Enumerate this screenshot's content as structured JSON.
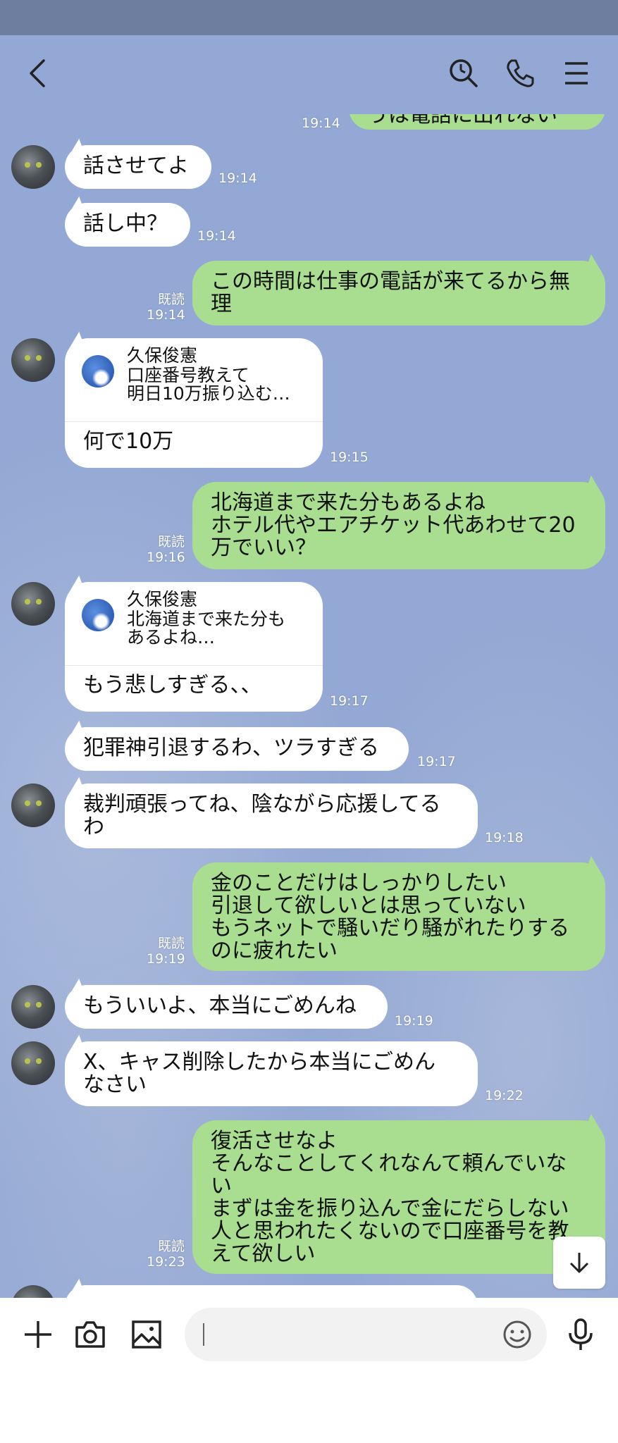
{
  "header": {
    "back_icon": "chevron-left-icon",
    "search_icon": "search-icon",
    "call_icon": "phone-icon",
    "menu_icon": "menu-icon"
  },
  "messages": [
    {
      "side": "out",
      "lines": [
        "うは電話に出れない"
      ],
      "time": "19:14",
      "read": ""
    },
    {
      "side": "in",
      "lines": [
        "話させてよ"
      ],
      "time": "19:14"
    },
    {
      "side": "in",
      "lines": [
        "話し中？"
      ],
      "time": "19:14"
    },
    {
      "side": "out",
      "lines": [
        "この時間は仕事の電話が来てるから無",
        "理"
      ],
      "time": "19:14",
      "read": "既読"
    },
    {
      "side": "in",
      "quote_name": "久保俊憲",
      "quote_lines": [
        "口座番号教えて",
        "明日10万振り込む…"
      ],
      "lines": [
        "何で10万"
      ],
      "time": "19:15"
    },
    {
      "side": "out",
      "lines": [
        "北海道まで来た分もあるよね",
        "ホテル代やエアチケット代あわせて20",
        "万でいい？"
      ],
      "time": "19:16",
      "read": "既読"
    },
    {
      "side": "in",
      "quote_name": "久保俊憲",
      "quote_lines": [
        "北海道まで来た分も",
        "あるよね…"
      ],
      "lines": [
        "もう悲しすぎる、、"
      ],
      "time": "19:17"
    },
    {
      "side": "in",
      "lines": [
        "犯罪神引退するわ、ツラすぎる"
      ],
      "time": "19:17"
    },
    {
      "side": "in",
      "lines": [
        "裁判頑張ってね、陰ながら応援してる",
        "わ"
      ],
      "time": "19:18"
    },
    {
      "side": "out",
      "lines": [
        "金のことだけはしっかりしたい",
        "引退して欲しいとは思っていない",
        "もうネットで騒いだり騒がれたりする",
        "のに疲れたい"
      ],
      "time": "19:19",
      "read": "既読"
    },
    {
      "side": "in",
      "lines": [
        "もういいよ、本当にごめんね"
      ],
      "time": "19:19"
    },
    {
      "side": "in",
      "lines": [
        "X、キャス削除したから本当にごめん",
        "なさい"
      ],
      "time": "19:22"
    },
    {
      "side": "out",
      "lines": [
        "復活させなよ",
        "そんなことしてくれなんて頼んでいな",
        "い",
        "まずは金を振り込んで金にだらしない",
        "人と思われたくないので口座番号を教",
        "えて欲しい"
      ],
      "time": "19:23",
      "read": "既読"
    }
  ],
  "input": {
    "placeholder": "",
    "plus_icon": "plus-icon",
    "camera_icon": "camera-icon",
    "image_icon": "image-icon",
    "emoji_icon": "emoji-icon",
    "mic_icon": "microphone-icon"
  },
  "scroll_icon": "arrow-down-icon"
}
